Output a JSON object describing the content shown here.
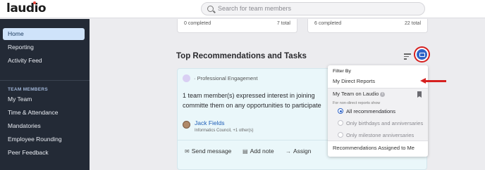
{
  "app": {
    "logo": "laudio"
  },
  "search": {
    "placeholder": "Search for team members"
  },
  "sidebar": {
    "items": [
      {
        "label": "Home",
        "active": true
      },
      {
        "label": "Reporting"
      },
      {
        "label": "Activity Feed"
      }
    ],
    "section_label": "TEAM MEMBERS",
    "team_items": [
      {
        "label": "My Team"
      },
      {
        "label": "Time & Attendance"
      },
      {
        "label": "Mandatories"
      },
      {
        "label": "Employee Rounding"
      },
      {
        "label": "Peer Feedback"
      }
    ]
  },
  "summary_cards": [
    {
      "completed": "0 completed",
      "total": "7 total"
    },
    {
      "completed": "6 completed",
      "total": "22 total"
    }
  ],
  "main": {
    "section_title": "Top Recommendations and Tasks"
  },
  "recommendation": {
    "category": "· Professional Engagement",
    "text": "1 team member(s) expressed interest in joining committe them on any opportunities to participate",
    "person_name": "Jack Fields",
    "person_sub": "Informatics Council, +1 other(s)",
    "actions": {
      "send_message": "Send message",
      "add_note": "Add note",
      "assign": "Assign"
    }
  },
  "dropdown": {
    "filter_by": "Filter By",
    "my_direct_reports": "My Direct Reports",
    "my_team": "My Team on Laudio",
    "info_glyph": "i",
    "note": "For non-direct reports show",
    "options": [
      {
        "label": "All recommendations",
        "selected": true
      },
      {
        "label": "Only birthdays and anniversaries",
        "selected": false
      },
      {
        "label": "Only milestone anniversaries",
        "selected": false
      }
    ],
    "assigned": "Recommendations Assigned to Me"
  },
  "colors": {
    "accent": "#2f64c8",
    "sidebar_bg": "#232a36",
    "highlight": "#d6201f",
    "card_bg": "#eaf7fa"
  }
}
